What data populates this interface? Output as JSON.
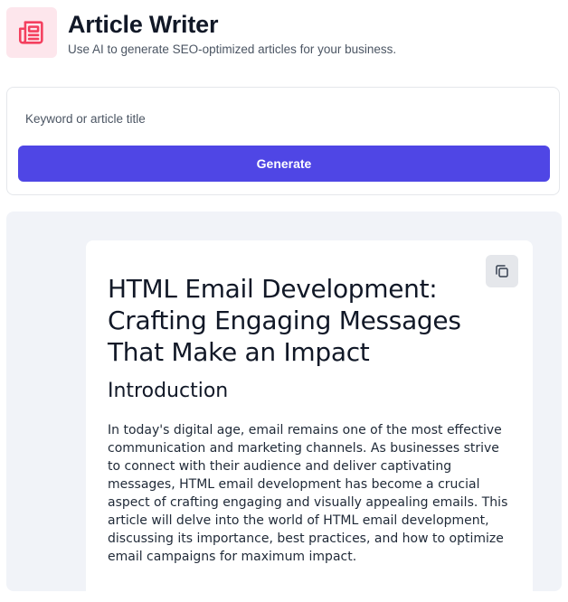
{
  "app": {
    "title": "Article Writer",
    "subtitle": "Use AI to generate SEO-optimized articles for your business.",
    "icon": "newspaper-icon",
    "accent_color": "#f43f5e",
    "icon_bg_color": "#fde6ec"
  },
  "form": {
    "keyword_placeholder": "Keyword or article title",
    "keyword_value": "",
    "generate_label": "Generate",
    "button_color": "#4f46e5"
  },
  "article": {
    "copy_icon": "copy-icon",
    "title": "HTML Email Development: Crafting Engaging Messages That Make an Impact",
    "heading": "Introduction",
    "paragraph": "In today's digital age, email remains one of the most effective communication and marketing channels. As businesses strive to connect with their audience and deliver captivating messages, HTML email development has become a crucial aspect of crafting engaging and visually appealing emails. This article will delve into the world of HTML email development, discussing its importance, best practices, and how to optimize email campaigns for maximum impact."
  }
}
